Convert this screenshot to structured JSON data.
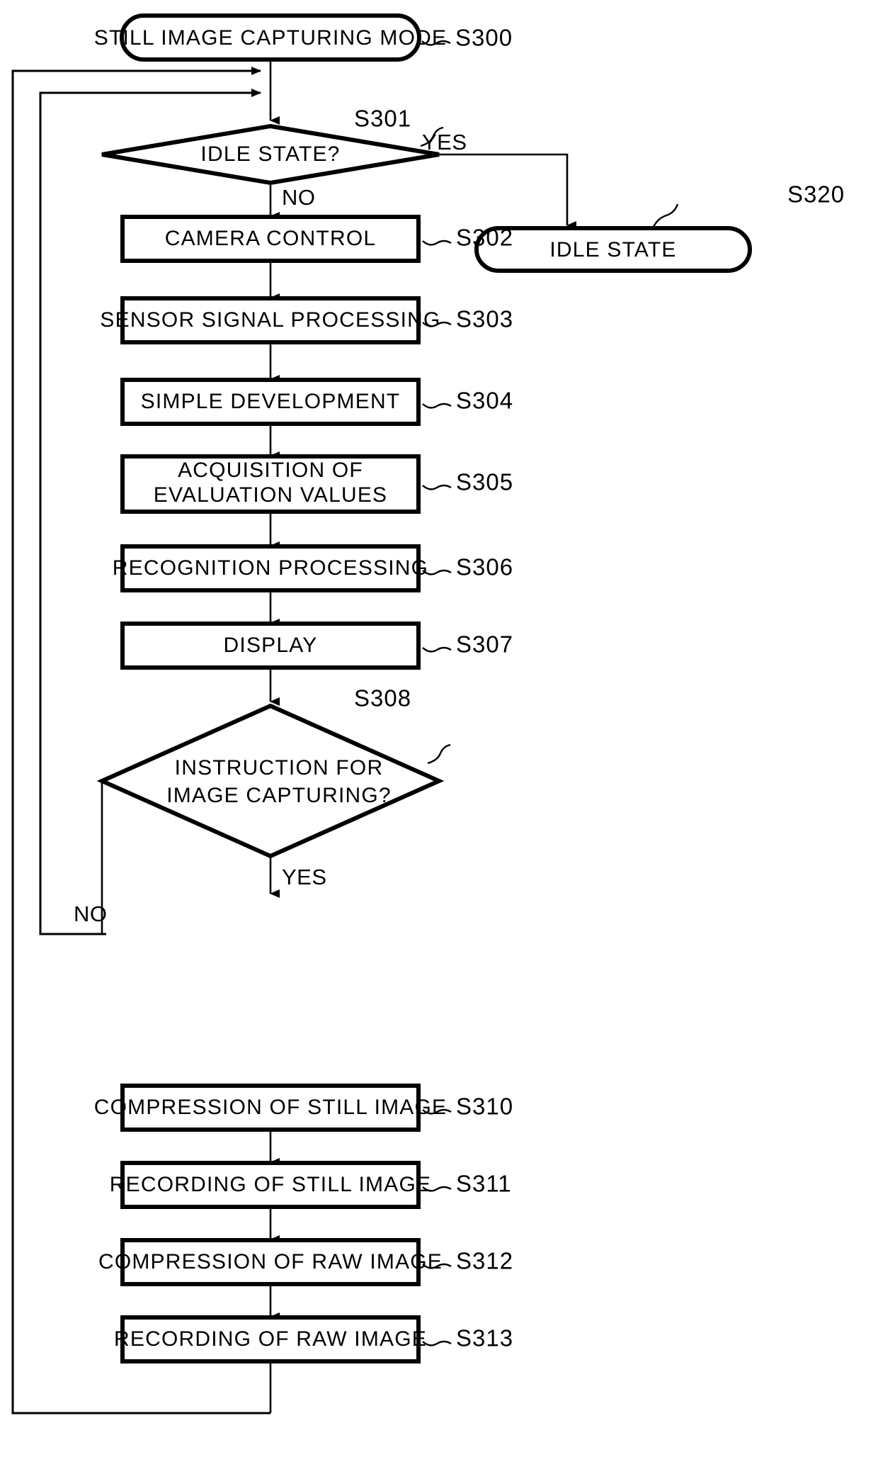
{
  "figure": {
    "caption": ""
  },
  "diagram": {
    "type": "flowchart",
    "orientation": "top-to-bottom",
    "terminals": [
      {
        "id": "S300",
        "label": "STILL IMAGE CAPTURING MODE",
        "ref": "S300",
        "shape": "rounded-terminal"
      },
      {
        "id": "S320",
        "label": "IDLE STATE",
        "ref": "S320",
        "shape": "rounded-terminal"
      }
    ],
    "decisions": [
      {
        "id": "S301",
        "label": "IDLE STATE?",
        "ref": "S301",
        "shape": "diamond",
        "yes_label": "YES",
        "no_label": "NO",
        "yes_target": "S320",
        "no_target": "S302"
      },
      {
        "id": "S308",
        "label_line1": "INSTRUCTION FOR",
        "label_line2": "IMAGE CAPTURING?",
        "ref": "S308",
        "shape": "diamond",
        "yes_label": "YES",
        "no_label": "NO",
        "yes_target": "S310",
        "no_target": "S301"
      }
    ],
    "processes": [
      {
        "id": "S302",
        "label": "CAMERA CONTROL",
        "ref": "S302",
        "shape": "rect"
      },
      {
        "id": "S303",
        "label": "SENSOR SIGNAL PROCESSING",
        "ref": "S303",
        "shape": "rect"
      },
      {
        "id": "S304",
        "label": "SIMPLE DEVELOPMENT",
        "ref": "S304",
        "shape": "rect"
      },
      {
        "id": "S305",
        "label_line1": "ACQUISITION OF",
        "label_line2": "EVALUATION VALUES",
        "ref": "S305",
        "shape": "rect"
      },
      {
        "id": "S306",
        "label": "RECOGNITION PROCESSING",
        "ref": "S306",
        "shape": "rect"
      },
      {
        "id": "S307",
        "label": "DISPLAY",
        "ref": "S307",
        "shape": "rect"
      },
      {
        "id": "S310",
        "label": "COMPRESSION OF STILL IMAGE",
        "ref": "S310",
        "shape": "rect"
      },
      {
        "id": "S311",
        "label": "RECORDING OF STILL IMAGE",
        "ref": "S311",
        "shape": "rect"
      },
      {
        "id": "S312",
        "label": "COMPRESSION OF RAW IMAGE",
        "ref": "S312",
        "shape": "rect"
      },
      {
        "id": "S313",
        "label": "RECORDING OF RAW IMAGE",
        "ref": "S313",
        "shape": "rect"
      }
    ],
    "loops": [
      {
        "from": "S313",
        "to": "S301",
        "path": "bottom-left-outer-return"
      },
      {
        "from": "S308",
        "to": "S301",
        "path": "left-inner-return",
        "label": "NO"
      }
    ],
    "colors": {
      "stroke": "#000000",
      "fill": "#ffffff",
      "background": "#ffffff"
    }
  }
}
